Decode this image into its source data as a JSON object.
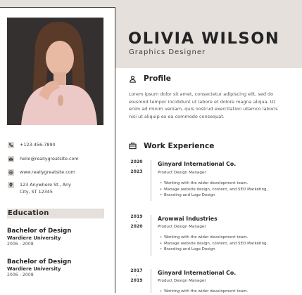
{
  "header": {
    "name": "OLIVIA WILSON",
    "title": "Graphics Designer"
  },
  "contact": {
    "phone": "+123-456-7890",
    "email": "hello@reallygreatsite.com",
    "website": "www.reallygreatsite.com",
    "address_line1": "123 Anywhere St., Any",
    "address_line2": "City, ST 12345"
  },
  "education": {
    "heading": "Education",
    "items": [
      {
        "degree": "Bachelor of Design",
        "school": "Wardiere University",
        "years": "2006 - 2008"
      },
      {
        "degree": "Bachelor of Design",
        "school": "Wardiere University",
        "years": "2006 - 2008"
      }
    ]
  },
  "profile": {
    "heading": "Profile",
    "lines": [
      "Lorem ipsum dolor sit amet, consectetur adipiscing elit, sed do",
      "eiusmod tempor incididunt ut labore et dolore magna aliqua. Ut",
      "enim ad minim veniam, quis nostrud exercitation ullamco laboris",
      "nisi ut aliquip ex ea commodo consequat."
    ]
  },
  "experience": {
    "heading": "Work Experience",
    "jobs": [
      {
        "start": "2020",
        "end": "2023",
        "company": "Ginyard International Co.",
        "role": "Product Design Manager",
        "bullets": [
          "Working with the wider development team.",
          "Manage website design, content, and SEO Marketing,",
          "Branding and Logo Design"
        ]
      },
      {
        "start": "2019",
        "end": "2020",
        "company": "Arowwai Industries",
        "role": "Product Design Manager",
        "bullets": [
          "Working with the wider development team.",
          "Manage website design, content, and SEO Marketing,",
          "Branding and Logo Design"
        ]
      },
      {
        "start": "2017",
        "end": "2019",
        "company": "Ginyard International Co.",
        "role": "Product Design Manager",
        "bullets": [
          "Working with the wider development team."
        ]
      }
    ]
  },
  "colors": {
    "accent_band": "#e6e0dc",
    "timeline": "#c9b9ae",
    "text_dark": "#232323"
  }
}
